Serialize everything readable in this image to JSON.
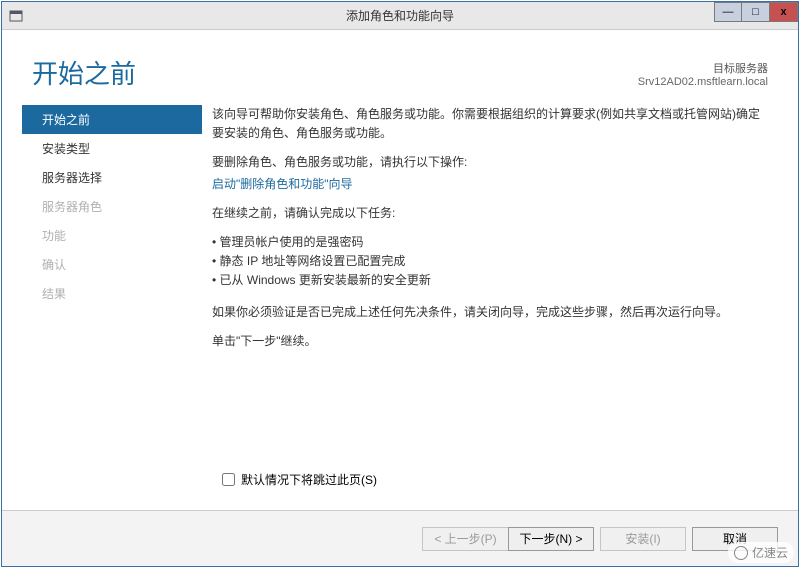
{
  "window": {
    "title": "添加角色和功能向导",
    "min": "—",
    "max": "□",
    "close": "x"
  },
  "header": {
    "page_title": "开始之前",
    "server_label": "目标服务器",
    "server_name": "Srv12AD02.msftlearn.local"
  },
  "sidebar": {
    "items": [
      {
        "label": "开始之前",
        "state": "active"
      },
      {
        "label": "安装类型",
        "state": "normal"
      },
      {
        "label": "服务器选择",
        "state": "normal"
      },
      {
        "label": "服务器角色",
        "state": "disabled"
      },
      {
        "label": "功能",
        "state": "disabled"
      },
      {
        "label": "确认",
        "state": "disabled"
      },
      {
        "label": "结果",
        "state": "disabled"
      }
    ]
  },
  "content": {
    "intro": "该向导可帮助你安装角色、角色服务或功能。你需要根据组织的计算要求(例如共享文档或托管网站)确定要安装的角色、角色服务或功能。",
    "remove_prompt": "要删除角色、角色服务或功能，请执行以下操作:",
    "remove_link": "启动\"删除角色和功能\"向导",
    "confirm_prompt": "在继续之前，请确认完成以下任务:",
    "bullets": [
      "管理员帐户使用的是强密码",
      "静态 IP 地址等网络设置已配置完成",
      "已从 Windows 更新安装最新的安全更新"
    ],
    "verify": "如果你必须验证是否已完成上述任何先决条件，请关闭向导，完成这些步骤，然后再次运行向导。",
    "continue": "单击\"下一步\"继续。",
    "skip_label": "默认情况下将跳过此页(S)"
  },
  "footer": {
    "prev": "< 上一步(P)",
    "next": "下一步(N) >",
    "install": "安装(I)",
    "cancel": "取消"
  },
  "watermark": "亿速云"
}
